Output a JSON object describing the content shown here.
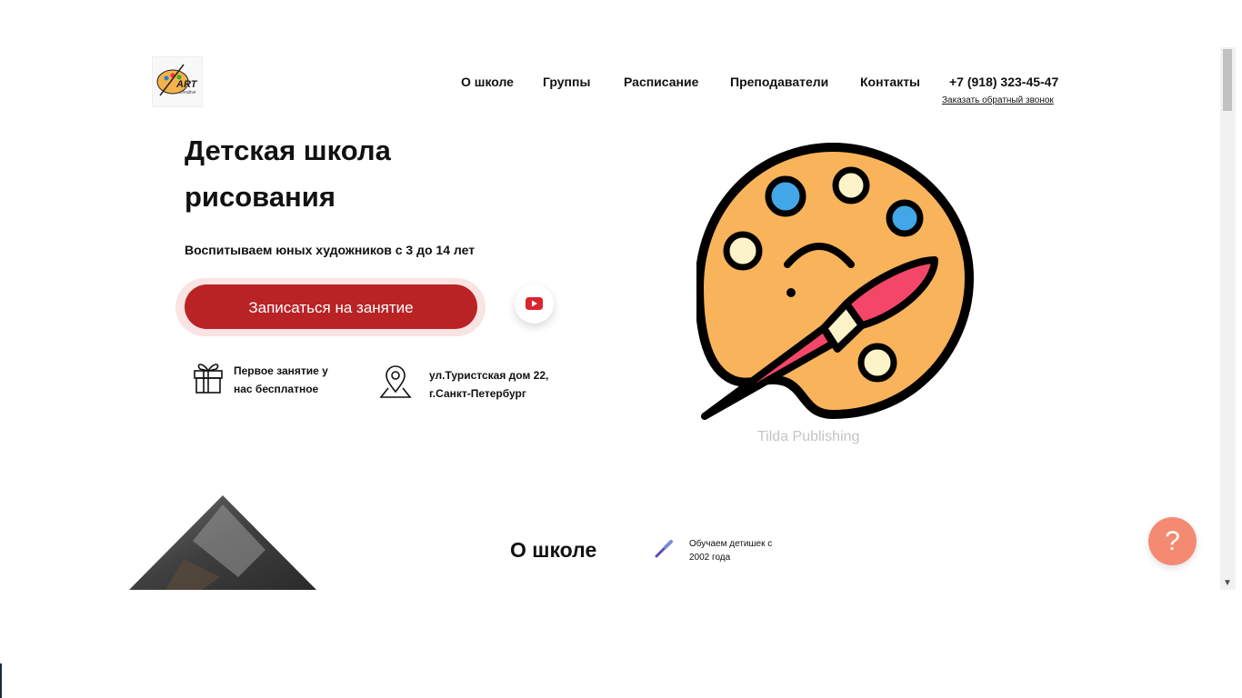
{
  "header": {
    "logo_text": "ART",
    "logo_subtext": "creative",
    "nav": [
      "О школе",
      "Группы",
      "Расписание",
      "Преподаватели",
      "Контакты"
    ],
    "phone": "+7 (918) 323-45-47",
    "callback_link": "Заказать обратный звонок"
  },
  "hero": {
    "title": "Детская школа рисования",
    "subtitle": "Воспитываем юных художников с 3 до 14 лет",
    "cta_label": "Записаться на занятие",
    "video_icon": "youtube-play-icon",
    "features": [
      {
        "icon": "gift-icon",
        "text": "Первое занятие у нас бесплатное"
      },
      {
        "icon": "map-pin-icon",
        "text": "ул.Туристская дом 22, г.Санкт-Петербург"
      }
    ],
    "image_caption": "Tilda Publishing"
  },
  "about": {
    "heading": "О школе",
    "fact_icon": "paintbrush-icon",
    "fact_text": "Обучаем детишек с 2002 года"
  },
  "help_button_label": "?",
  "colors": {
    "accent": "#b92326",
    "palette": "#f9b35a",
    "brush": "#f44668",
    "help": "#f58a72"
  }
}
